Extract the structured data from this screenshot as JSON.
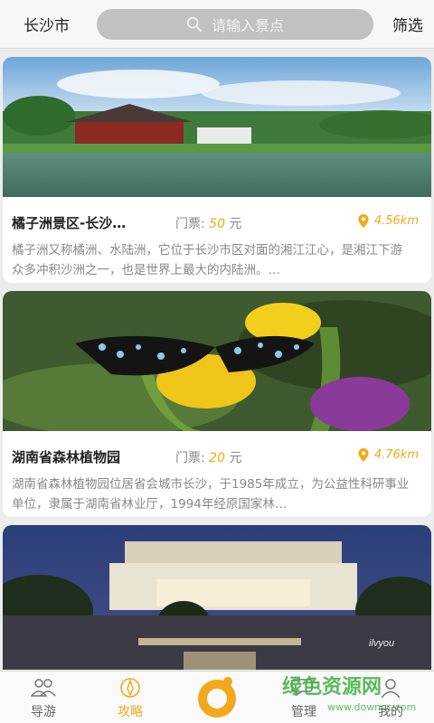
{
  "header": {
    "city": "长沙市",
    "search_placeholder": "请输入景点",
    "filter": "筛选"
  },
  "spots": [
    {
      "title": "橘子洲景区-长沙…",
      "ticket_label": "门票:",
      "price": "50",
      "unit": "元",
      "distance": "4.56km",
      "description": "橘子洲又称橘洲、水陆洲，它位于长沙市区对面的湘江江心，是湘江下游 众多冲积沙洲之一，也是世界上最大的内陆洲。…"
    },
    {
      "title": "湖南省森林植物园",
      "ticket_label": "门票:",
      "price": "20",
      "unit": "元",
      "distance": "4.76km",
      "description": "湖南省森林植物园位居省会城市长沙，于1985年成立，为公益性科研事业单位，隶属于湖南省林业厅，1994年经原国家林…"
    }
  ],
  "photo_caption": "ilvyou",
  "nav": {
    "items": [
      {
        "label": "导游",
        "icon": "people-icon"
      },
      {
        "label": "攻略",
        "icon": "compass-icon"
      },
      {
        "label": "",
        "icon": "center-logo-icon"
      },
      {
        "label": "管理",
        "icon": "chat-icon"
      },
      {
        "label": "我的",
        "icon": "person-icon"
      }
    ]
  },
  "watermark": {
    "main": "绿色资源网",
    "sub": "www.downcc.com"
  },
  "colors": {
    "accent": "#f1a91b",
    "search_bg": "#c1c1c1"
  }
}
